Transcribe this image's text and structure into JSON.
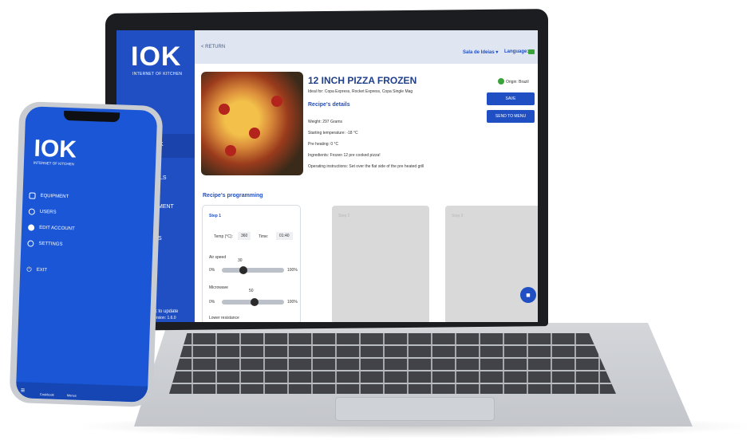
{
  "brand": {
    "logo": "IOK",
    "subtitle": "INTERNET OF KITCHEN"
  },
  "laptop": {
    "topbar": {
      "return_label": "< RETURN",
      "ideas_label": "Sala de Ideias ▾",
      "language_label": "Language:",
      "language_icon": "brazil-flag-icon"
    },
    "sidebar": {
      "fragment_1": "K",
      "fragment_2": "ILS",
      "fragment_3": "MENT",
      "fragment_4": "S",
      "update_label": "lick to update",
      "version_label": "Version: 1.6.0"
    },
    "recipe": {
      "title": "12 INCH PIZZA FROZEN",
      "ideal_for": "Ideal for: Copa Express, Rocket Express, Copa Single Mag",
      "details_heading": "Recipe's details",
      "weight": "Weight: 297 Grams",
      "starting_temperature": "Starting temperature: -18 °C",
      "preheating": "Pre heating: 0 °C",
      "ingredients": "Ingredients: Frozen 12 pre cooked pizza!",
      "operating_instructions": "Operating instructions: Set over the flat side of the pre heated grill",
      "origin": "Origin: Brazil"
    },
    "buttons": {
      "save": "SAVE",
      "send_to_menu": "SEND TO MENU"
    },
    "programming": {
      "heading": "Recipe's programming",
      "step": {
        "title": "Step 1",
        "temp_label": "Temp (°C):",
        "temp_value": "360",
        "time_label": "Time:",
        "time_value": "01:40",
        "air_speed_label": "Air speed",
        "air_speed_value": "30",
        "microwave_label": "Microwave",
        "microwave_value": "50",
        "min_label": "0%",
        "max_label": "100%",
        "lower_resistance_label": "Lower resistance"
      },
      "faded_steps": [
        "Step 2",
        "Step 3"
      ]
    }
  },
  "phone": {
    "menu": [
      "EQUIPMENT",
      "USERS",
      "EDIT ACCOUNT",
      "SETTINGS"
    ],
    "exit": "EXIT",
    "tabs": [
      "Cookbook",
      "Menus"
    ]
  }
}
